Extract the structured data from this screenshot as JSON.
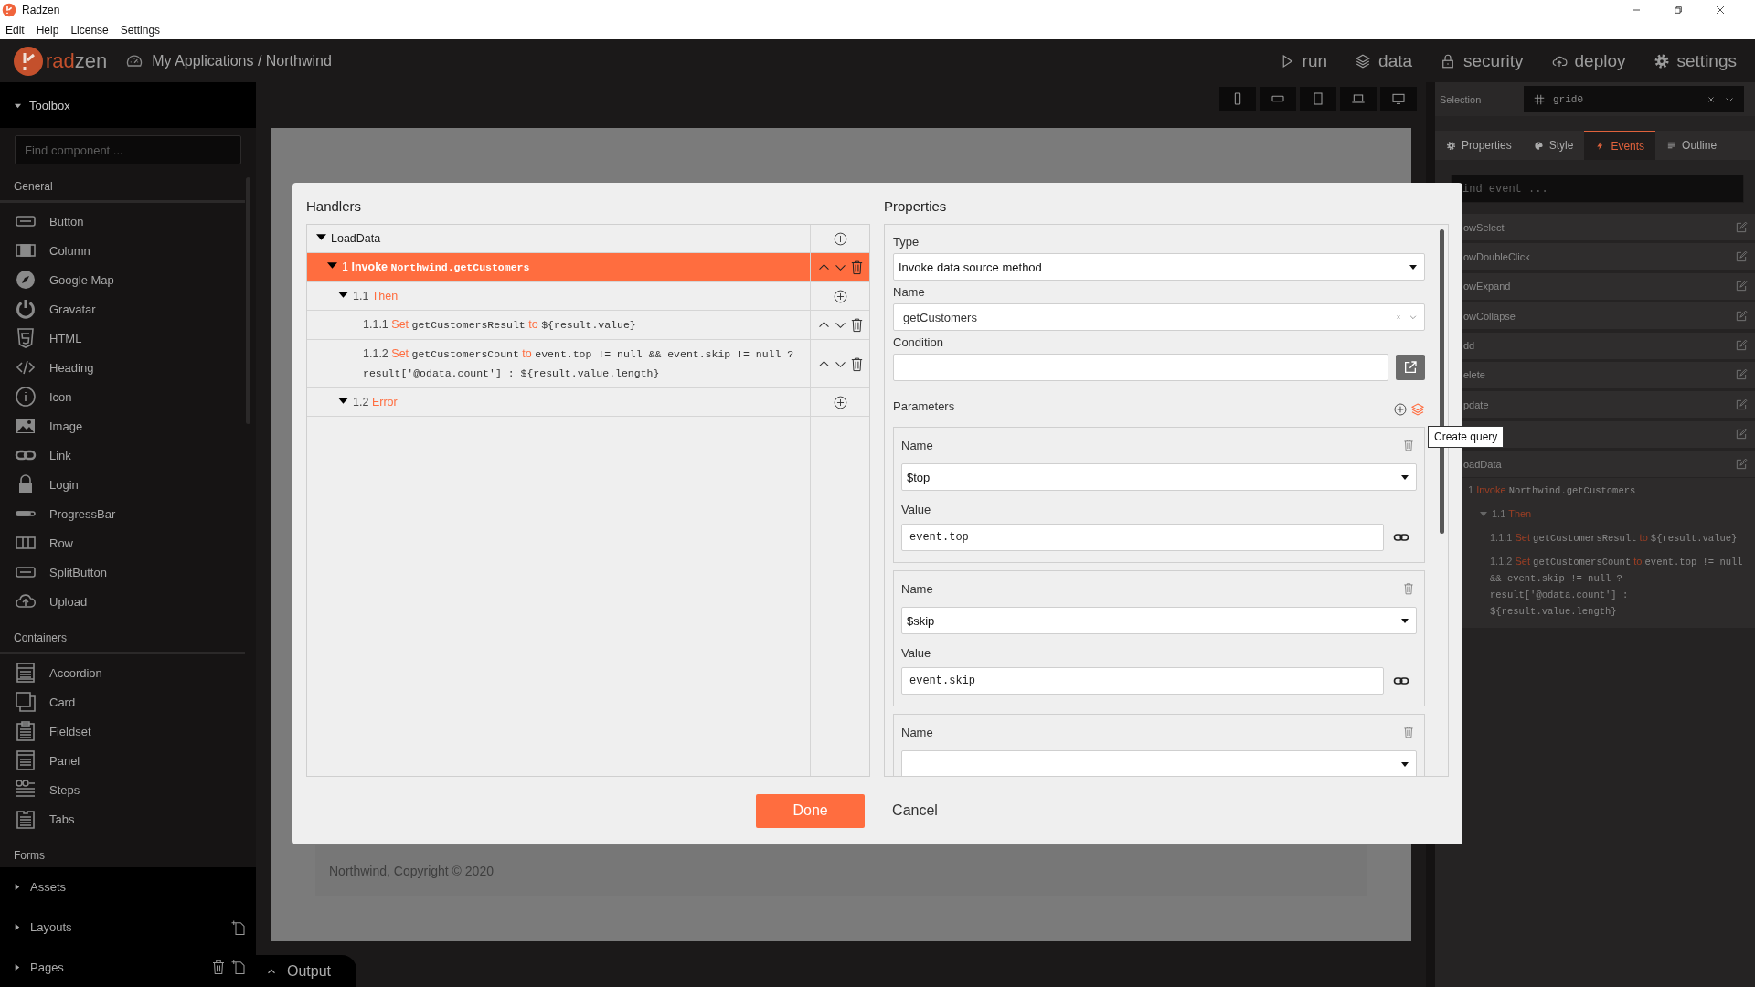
{
  "window": {
    "title": "Radzen"
  },
  "menu": [
    {
      "label": "Edit"
    },
    {
      "label": "Help"
    },
    {
      "label": "License"
    },
    {
      "label": "Settings"
    }
  ],
  "header": {
    "logo_parts": [
      "rad",
      "zen"
    ],
    "breadcrumb": "My Applications / Northwind",
    "nav": [
      {
        "label": "run",
        "kind": "play"
      },
      {
        "label": "data",
        "kind": "layers"
      },
      {
        "label": "security",
        "kind": "lock"
      },
      {
        "label": "deploy",
        "kind": "cloud"
      },
      {
        "label": "settings",
        "kind": "gear"
      }
    ]
  },
  "toolbox": {
    "title": "Toolbox",
    "expanded": true,
    "placeholder": "Find component ...",
    "groups": [
      {
        "name": "General",
        "items": [
          {
            "label": "Button",
            "kind": "button"
          },
          {
            "label": "Column",
            "kind": "column"
          },
          {
            "label": "Google Map",
            "kind": "map"
          },
          {
            "label": "Gravatar",
            "kind": "gravatar"
          },
          {
            "label": "HTML",
            "kind": "html"
          },
          {
            "label": "Heading",
            "kind": "heading"
          },
          {
            "label": "Icon",
            "kind": "info"
          },
          {
            "label": "Image",
            "kind": "image"
          },
          {
            "label": "Link",
            "kind": "link"
          },
          {
            "label": "Login",
            "kind": "lock"
          },
          {
            "label": "ProgressBar",
            "kind": "progress"
          },
          {
            "label": "Row",
            "kind": "row"
          },
          {
            "label": "SplitButton",
            "kind": "button"
          },
          {
            "label": "Upload",
            "kind": "upload"
          }
        ]
      },
      {
        "name": "Containers",
        "items": [
          {
            "label": "Accordion",
            "kind": "accordion"
          },
          {
            "label": "Card",
            "kind": "card"
          },
          {
            "label": "Fieldset",
            "kind": "fieldset"
          },
          {
            "label": "Panel",
            "kind": "panel"
          },
          {
            "label": "Steps",
            "kind": "steps"
          },
          {
            "label": "Tabs",
            "kind": "tabs"
          }
        ]
      },
      {
        "name": "Forms"
      }
    ]
  },
  "sections": [
    {
      "label": "Assets",
      "expanded": false
    },
    {
      "label": "Layouts",
      "expanded": false
    },
    {
      "label": "Pages",
      "expanded": false
    }
  ],
  "output": {
    "label": "Output",
    "expanded": false
  },
  "devices": [
    {
      "kind": "phone"
    },
    {
      "kind": "phone-landscape"
    },
    {
      "kind": "tablet"
    },
    {
      "kind": "laptop"
    },
    {
      "kind": "desktop"
    }
  ],
  "canvas": {
    "footer": "Northwind, Copyright © 2020"
  },
  "inspector": {
    "selection_label": "Selection",
    "selection_value": "grid0",
    "tabs": [
      {
        "label": "Properties",
        "kind": "gear",
        "selected": false
      },
      {
        "label": "Style",
        "kind": "palette",
        "selected": false
      },
      {
        "label": "Events",
        "kind": "bolt",
        "selected": true
      },
      {
        "label": "Outline",
        "kind": "list",
        "selected": false
      }
    ],
    "placeholder": "ind event ...",
    "events": [
      {
        "kind": "event",
        "name": "owSelect"
      },
      {
        "kind": "event",
        "name": "owDoubleClick"
      },
      {
        "kind": "event",
        "name": "owExpand"
      },
      {
        "kind": "event",
        "name": "owCollapse"
      },
      {
        "kind": "event",
        "name": "dd"
      },
      {
        "kind": "event",
        "name": "elete"
      },
      {
        "kind": "event",
        "name": "pdate"
      },
      {
        "kind": "event"
      },
      {
        "kind": "event",
        "name": "oadData"
      }
    ],
    "handlers": [
      {
        "parts": [
          {
            "kind": "number",
            "text": "1"
          },
          {
            "kind": "keyword",
            "text": "Invoke"
          },
          {
            "kind": "code",
            "text": "Northwind.getCustomers"
          }
        ],
        "children": [
          {
            "parts": [
              {
                "kind": "number",
                "text": "1.1"
              },
              {
                "kind": "keyword",
                "text": "Then"
              }
            ],
            "expanded": true,
            "children": [
              {
                "parts": [
                  {
                    "kind": "number",
                    "text": "1.1.1"
                  },
                  {
                    "kind": "keyword",
                    "text": "Set"
                  },
                  {
                    "kind": "code",
                    "text": "getCustomersResult"
                  },
                  {
                    "kind": "keyword",
                    "text": "to"
                  },
                  {
                    "kind": "code",
                    "text": "${result.value}"
                  }
                ]
              },
              {
                "parts": [
                  {
                    "kind": "number",
                    "text": "1.1.2"
                  },
                  {
                    "kind": "keyword",
                    "text": "Set"
                  },
                  {
                    "kind": "code",
                    "text": "getCustomersCount"
                  },
                  {
                    "kind": "keyword",
                    "text": "to"
                  },
                  {
                    "kind": "code",
                    "text": "event.top != null && event.skip != null ? result['@odata.count'] : ${result.value.length}"
                  }
                ]
              }
            ]
          }
        ]
      }
    ]
  },
  "dialog": {
    "handlers": {
      "title": "Handlers",
      "tree": [
        {
          "kind": "event",
          "parts": [
            {
              "kind": "text",
              "text": "LoadData"
            }
          ],
          "expanded": true,
          "selected": false,
          "children": [
            {
              "kind": "action",
              "parts": [
                {
                  "kind": "number",
                  "text": "1"
                },
                {
                  "kind": "keyword",
                  "text": "Invoke"
                },
                {
                  "kind": "code",
                  "text": "Northwind.getCustomers"
                }
              ],
              "expanded": true,
              "selected": true,
              "children": [
                {
                  "kind": "branch",
                  "parts": [
                    {
                      "kind": "number",
                      "text": "1.1"
                    },
                    {
                      "kind": "keyword",
                      "text": "Then"
                    }
                  ],
                  "expanded": true,
                  "selected": false,
                  "children": [
                    {
                      "kind": "action",
                      "parts": [
                        {
                          "kind": "number",
                          "text": "1.1.1"
                        },
                        {
                          "kind": "keyword",
                          "text": "Set"
                        },
                        {
                          "kind": "code",
                          "text": "getCustomersResult"
                        },
                        {
                          "kind": "keyword",
                          "text": "to"
                        },
                        {
                          "kind": "code",
                          "text": "${result.value}"
                        }
                      ],
                      "selected": false
                    },
                    {
                      "kind": "action",
                      "parts": [
                        {
                          "kind": "number",
                          "text": "1.1.2"
                        },
                        {
                          "kind": "keyword",
                          "text": "Set"
                        },
                        {
                          "kind": "code",
                          "text": "getCustomersCount"
                        },
                        {
                          "kind": "keyword",
                          "text": "to"
                        },
                        {
                          "kind": "code",
                          "text": "event.top != null && event.skip != null ? result['@odata.count'] : ${result.value.length}"
                        }
                      ],
                      "selected": false
                    }
                  ]
                },
                {
                  "kind": "branch",
                  "parts": [
                    {
                      "kind": "number",
                      "text": "1.2"
                    },
                    {
                      "kind": "keyword",
                      "text": "Error"
                    }
                  ],
                  "expanded": true,
                  "selected": false
                }
              ]
            }
          ]
        }
      ]
    },
    "properties": {
      "title": "Properties",
      "type": {
        "label": "Type",
        "value": "Invoke data source method"
      },
      "name": {
        "label": "Name",
        "value": "getCustomers"
      },
      "condition": {
        "label": "Condition"
      },
      "parameters_label": "Parameters",
      "parameters": [
        {
          "name_label": "Name",
          "name": "$top",
          "value_label": "Value",
          "value": "event.top"
        },
        {
          "name_label": "Name",
          "name": "$skip",
          "value_label": "Value",
          "value": "event.skip"
        },
        {
          "name_label": "Name"
        }
      ]
    },
    "buttons": [
      {
        "label": "Done",
        "kind": "primary"
      },
      {
        "label": "Cancel",
        "kind": "text"
      }
    ]
  },
  "tooltip": "Create query"
}
